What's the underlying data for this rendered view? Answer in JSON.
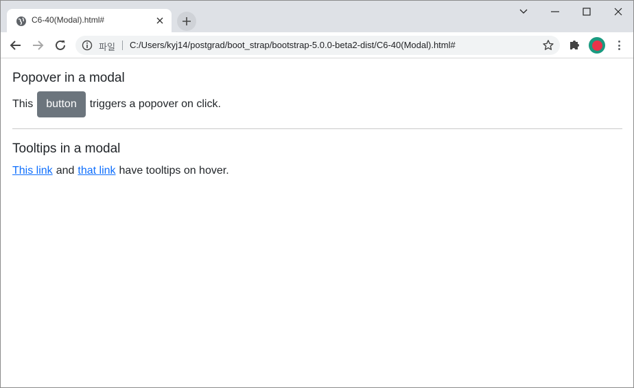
{
  "browser": {
    "tab_title": "C6-40(Modal).html#",
    "file_label": "파일",
    "url": "C:/Users/kyj14/postgrad/boot_strap/bootstrap-5.0.0-beta2-dist/C6-40(Modal).html#"
  },
  "page": {
    "popover_heading": "Popover in a modal",
    "popover_prefix": "This",
    "popover_button": "button",
    "popover_suffix": "triggers a popover on click.",
    "tooltips_heading": "Tooltips in a modal",
    "link1": "This link",
    "and_text": "and",
    "link2": "that link",
    "tooltip_suffix": "have tooltips on hover."
  },
  "colors": {
    "button_bg": "#6c757d",
    "link": "#0d6efd",
    "profile_ring": "#1a9a80",
    "profile_fill": "#e8334a"
  },
  "icons": [
    "globe-icon",
    "close-icon",
    "plus-icon",
    "chevron-down-icon",
    "minimize-icon",
    "maximize-icon",
    "window-close-icon",
    "back-arrow-icon",
    "forward-arrow-icon",
    "reload-icon",
    "info-icon",
    "star-icon",
    "puzzle-icon",
    "kebab-menu-icon"
  ]
}
